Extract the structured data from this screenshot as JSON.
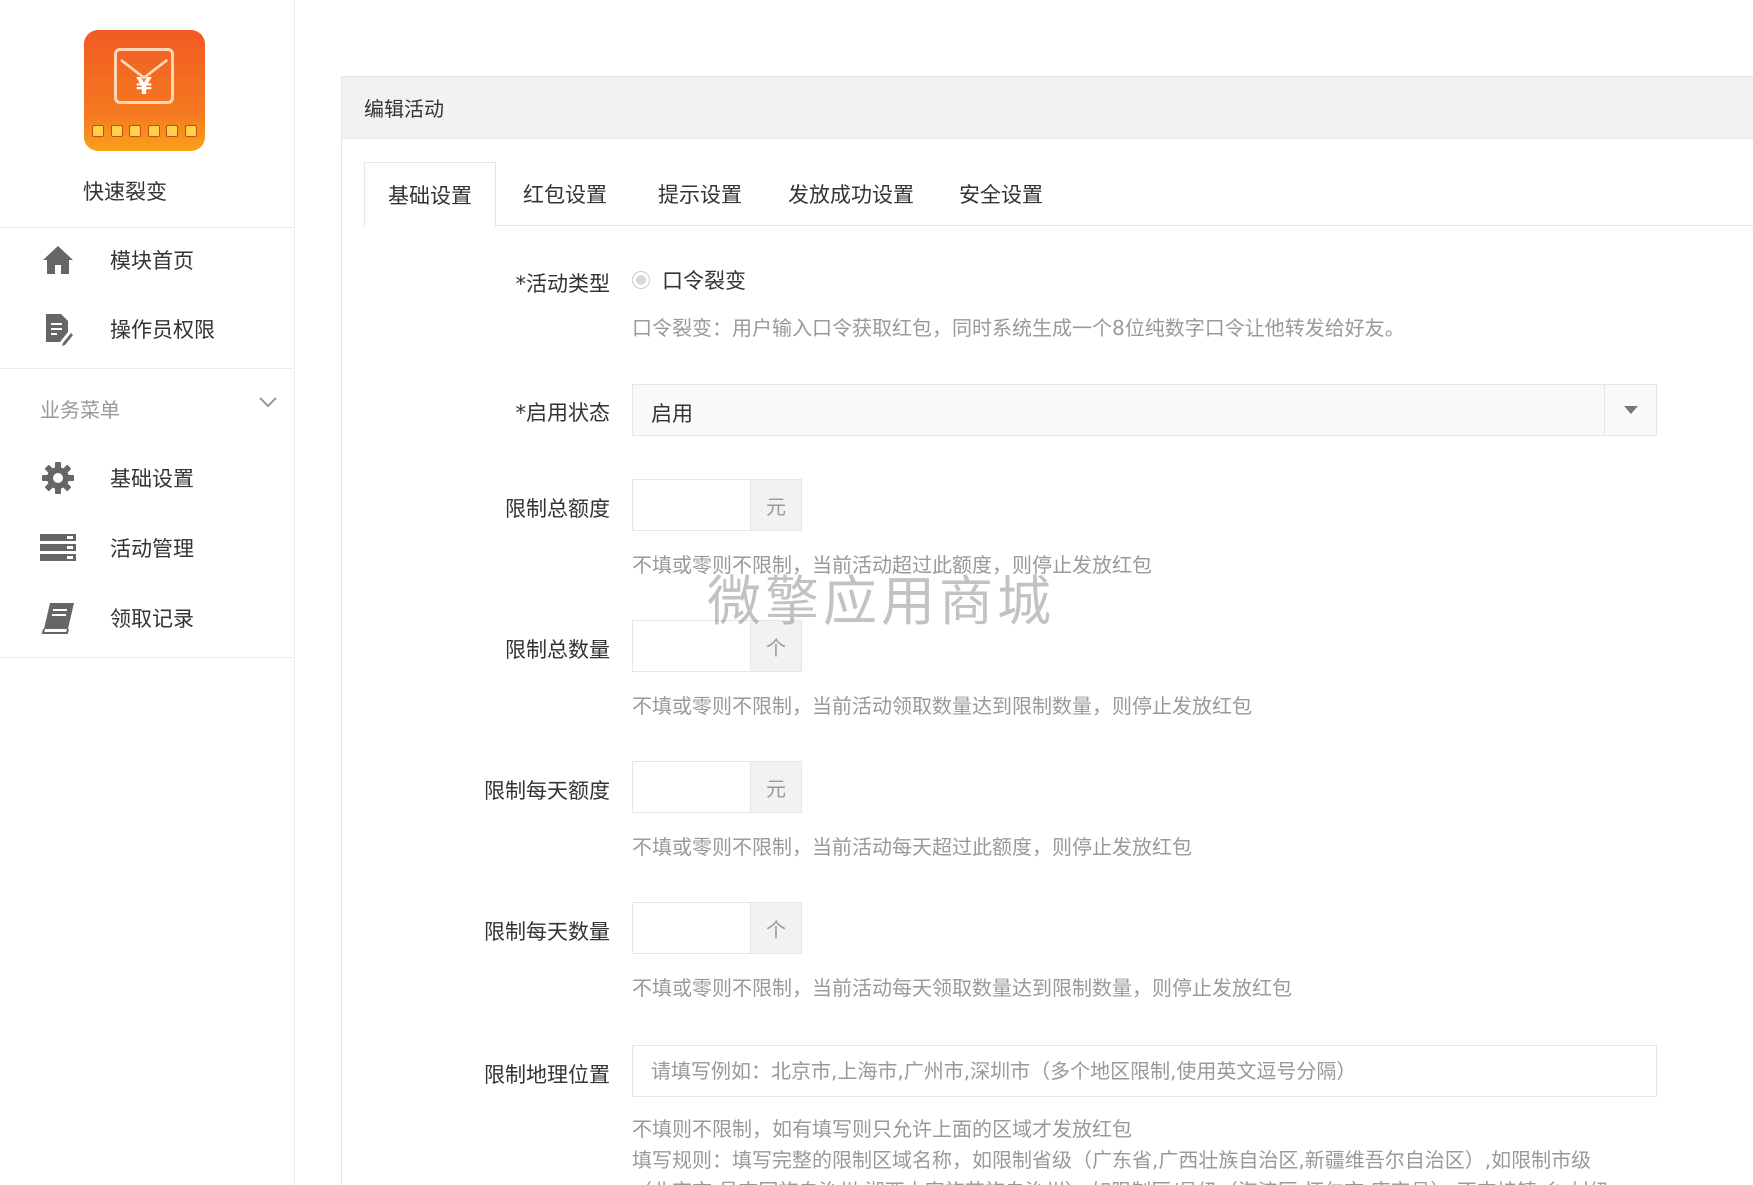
{
  "sidebar": {
    "app_name": "快速裂变",
    "items_top": [
      {
        "label": "模块首页"
      },
      {
        "label": "操作员权限"
      }
    ],
    "menu_title": "业务菜单",
    "items_business": [
      {
        "label": "基础设置"
      },
      {
        "label": "活动管理"
      },
      {
        "label": "领取记录"
      }
    ]
  },
  "panel": {
    "title": "编辑活动",
    "tabs": [
      {
        "label": "基础设置",
        "active": true
      },
      {
        "label": "红包设置"
      },
      {
        "label": "提示设置"
      },
      {
        "label": "发放成功设置"
      },
      {
        "label": "安全设置"
      }
    ]
  },
  "form": {
    "activity_type": {
      "label": "*活动类型",
      "option": "口令裂变",
      "help": "口令裂变：用户输入口令获取红包，同时系统生成一个8位纯数字口令让他转发给好友。"
    },
    "status": {
      "label": "*启用状态",
      "value": "启用"
    },
    "total_amount": {
      "label": "限制总额度",
      "unit": "元",
      "value": "",
      "help": "不填或零则不限制，当前活动超过此额度，则停止发放红包"
    },
    "total_count": {
      "label": "限制总数量",
      "unit": "个",
      "value": "",
      "help": "不填或零则不限制，当前活动领取数量达到限制数量，则停止发放红包"
    },
    "daily_amount": {
      "label": "限制每天额度",
      "unit": "元",
      "value": "",
      "help": "不填或零则不限制，当前活动每天超过此额度，则停止发放红包"
    },
    "daily_count": {
      "label": "限制每天数量",
      "unit": "个",
      "value": "",
      "help": "不填或零则不限制，当前活动每天领取数量达到限制数量，则停止发放红包"
    },
    "geo": {
      "label": "限制地理位置",
      "placeholder": "请填写例如：北京市,上海市,广州市,深圳市（多个地区限制,使用英文逗号分隔）",
      "help1": "不填则不限制，如有填写则只允许上面的区域才发放红包",
      "help2": "填写规则：填写完整的限制区域名称，如限制省级（广东省,广西壮族自治区,新疆维吾尔自治区）,如限制市级",
      "help3": "（北京市,昌吉回族自治州,湘西土家族苗族自治州）,如限制区/县级（海淀区,怀仁市,康定县）,不支持镇,乡,村级"
    }
  },
  "watermark": "微擎应用商城",
  "colors": {
    "logo_orange": "#f15a24",
    "logo_yellow": "#ffd24a",
    "icon_gray": "#666666",
    "help_gray": "#999999"
  }
}
